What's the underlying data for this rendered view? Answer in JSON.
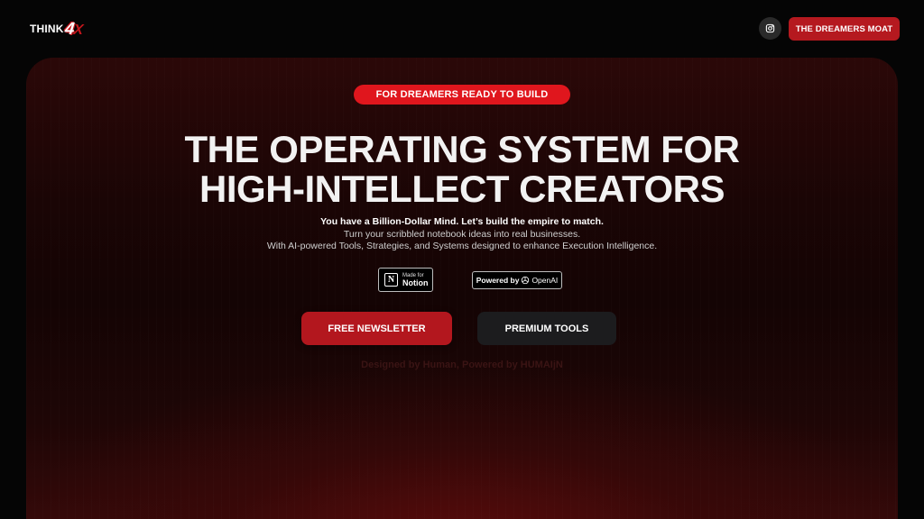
{
  "header": {
    "logo_text": "THINK",
    "logo_mark": "4",
    "logo_mark_x": "X",
    "instagram_icon": "instagram-icon",
    "cta_label": "THE DREAMERS MOAT"
  },
  "hero": {
    "pill_label": "FOR DREAMERS READY TO BUILD",
    "headline_line1": "THE OPERATING SYSTEM FOR",
    "headline_line2": "HIGH-INTELLECT CREATORS",
    "subline1": "You have a Billion-Dollar Mind. Let’s build the empire to match.",
    "subline2": "Turn your scribbled notebook ideas into real businesses.",
    "subline3": "With AI-powered Tools, Strategies, and Systems designed to enhance Execution Intelligence.",
    "notion_badge_small": "Made for",
    "notion_badge_big": "Notion",
    "notion_logo_letter": "N",
    "openai_badge_prefix": "Powered by",
    "openai_badge_name": "OpenAI",
    "newsletter_label": "FREE NEWSLETTER",
    "premium_label": "PREMIUM TOOLS",
    "credit_line": "Designed by Human, Powered by HUMAIjN"
  },
  "colors": {
    "accent_red": "#b5191f",
    "pill_red": "#e0161d",
    "dark_button": "#1c1c1e",
    "background": "#050505"
  }
}
